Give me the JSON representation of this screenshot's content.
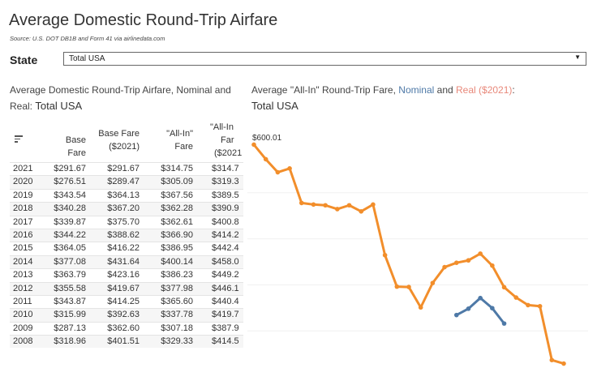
{
  "title": "Average Domestic Round-Trip Airfare",
  "source": "Source: U.S. DOT DB1B and Form 41 via airlinedata.com",
  "filter": {
    "label": "State",
    "selected": "Total USA"
  },
  "table": {
    "title": "Average Domestic Round-Trip Airfare, Nominal and Real:",
    "title_value": "Total USA",
    "headers": [
      {
        "line1": "",
        "line2": "Base Fare",
        "line3": ""
      },
      {
        "line1": "Base Fare",
        "line2": "($2021)",
        "line3": ""
      },
      {
        "line1": "\"All-In\"",
        "line2": "Fare",
        "line3": ""
      },
      {
        "line1": "\"All-In",
        "line2": "Far",
        "line3": "($2021"
      }
    ],
    "rows": [
      [
        "2021",
        "$291.67",
        "$291.67",
        "$314.75",
        "$314.7"
      ],
      [
        "2020",
        "$276.51",
        "$289.47",
        "$305.09",
        "$319.3"
      ],
      [
        "2019",
        "$343.54",
        "$364.13",
        "$367.56",
        "$389.5"
      ],
      [
        "2018",
        "$340.28",
        "$367.20",
        "$362.28",
        "$390.9"
      ],
      [
        "2017",
        "$339.87",
        "$375.70",
        "$362.61",
        "$400.8"
      ],
      [
        "2016",
        "$344.22",
        "$388.62",
        "$366.90",
        "$414.2"
      ],
      [
        "2015",
        "$364.05",
        "$416.22",
        "$386.95",
        "$442.4"
      ],
      [
        "2014",
        "$377.08",
        "$431.64",
        "$400.14",
        "$458.0"
      ],
      [
        "2013",
        "$363.79",
        "$423.16",
        "$386.23",
        "$449.2"
      ],
      [
        "2012",
        "$355.58",
        "$419.67",
        "$377.98",
        "$446.1"
      ],
      [
        "2011",
        "$343.87",
        "$414.25",
        "$365.60",
        "$440.4"
      ],
      [
        "2010",
        "$315.99",
        "$392.63",
        "$337.78",
        "$419.7"
      ],
      [
        "2009",
        "$287.13",
        "$362.60",
        "$307.18",
        "$387.9"
      ],
      [
        "2008",
        "$318.96",
        "$401.51",
        "$329.33",
        "$414.5"
      ]
    ]
  },
  "chart_title": {
    "prefix": "Average \"All-In\" Round-Trip Fare,",
    "nominal": "Nominal",
    "and": "and",
    "real": "Real ($2021)",
    "colon": ":",
    "value": "Total USA"
  },
  "chart_data": {
    "type": "line",
    "max_label": "$600.01",
    "ylim": [
      310,
      610
    ],
    "series": [
      {
        "name": "Real ($2021)",
        "color": "#f28e2b",
        "points": [
          [
            1995,
            600.01
          ],
          [
            1996,
            581.0
          ],
          [
            1997,
            564.0
          ],
          [
            1998,
            569.0
          ],
          [
            1999,
            524.0
          ],
          [
            2000,
            522.0
          ],
          [
            2001,
            521.0
          ],
          [
            2002,
            516.0
          ],
          [
            2003,
            521.0
          ],
          [
            2004,
            513.0
          ],
          [
            2005,
            522.0
          ],
          [
            2006,
            456.0
          ],
          [
            2007,
            415.0
          ],
          [
            2008,
            414.5
          ],
          [
            2009,
            387.9
          ],
          [
            2010,
            419.7
          ],
          [
            2011,
            440.4
          ],
          [
            2012,
            446.1
          ],
          [
            2013,
            449.2
          ],
          [
            2014,
            458.0
          ],
          [
            2015,
            442.4
          ],
          [
            2016,
            414.2
          ],
          [
            2017,
            400.8
          ],
          [
            2018,
            390.9
          ],
          [
            2019,
            389.5
          ],
          [
            2020,
            319.3
          ],
          [
            2021,
            314.7
          ]
        ]
      },
      {
        "name": "Nominal",
        "color": "#4e79a7",
        "points": [
          [
            2012,
            377.98
          ],
          [
            2013,
            386.23
          ],
          [
            2014,
            400.14
          ],
          [
            2015,
            386.95
          ],
          [
            2016,
            366.9
          ]
        ]
      }
    ]
  }
}
